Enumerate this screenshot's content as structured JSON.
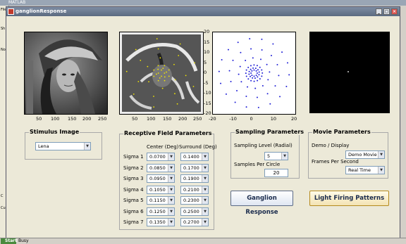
{
  "matlab": {
    "title": "MATLAB",
    "side_labels": [
      "File",
      "Sh",
      "Cu",
      "C",
      "No"
    ]
  },
  "window": {
    "title": "ganglionResponse",
    "controls": {
      "minimize": "_",
      "maximize": "▢",
      "close": "×"
    }
  },
  "axes": {
    "image_x_ticks": [
      "50",
      "100",
      "150",
      "200",
      "250"
    ],
    "scatter_x_ticks": [
      "-20",
      "-10",
      "0",
      "10",
      "20"
    ],
    "scatter_y_ticks": [
      "20",
      "15",
      "10",
      "5",
      "0",
      "-5",
      "-10",
      "-15",
      "-20"
    ]
  },
  "chart_data": {
    "type": "scatter",
    "xlim": [
      -20,
      20
    ],
    "ylim": [
      -20,
      20
    ],
    "grid": false,
    "color": "#1f1fd6",
    "rings": [
      {
        "radius": 1.5,
        "points": 8
      },
      {
        "radius": 2.5,
        "points": 12
      },
      {
        "radius": 4.0,
        "points": 16
      },
      {
        "radius": 7.5,
        "points": 12
      },
      {
        "radius": 12.0,
        "points": 14
      },
      {
        "radius": 17.0,
        "points": 18
      }
    ]
  },
  "stimulus": {
    "title": "Stimulus Image",
    "selected": "Lena"
  },
  "receptive": {
    "title": "Receptive Field Parameters",
    "center_header": "Center (Deg)",
    "surround_header": "Surround (Deg)",
    "rows": [
      {
        "label": "Sigma 1",
        "center": "0.0700",
        "surround": "0.1400"
      },
      {
        "label": "Sigma 2",
        "center": "0.0850",
        "surround": "0.1700"
      },
      {
        "label": "Sigma 3",
        "center": "0.0950",
        "surround": "0.1900"
      },
      {
        "label": "Sigma 4",
        "center": "0.1050",
        "surround": "0.2100"
      },
      {
        "label": "Sigma 5",
        "center": "0.1150",
        "surround": "0.2300"
      },
      {
        "label": "Sigma 6",
        "center": "0.1250",
        "surround": "0.2500"
      },
      {
        "label": "Sigma 7",
        "center": "0.1350",
        "surround": "0.2700"
      }
    ]
  },
  "sampling": {
    "title": "Sampling Parameters",
    "level_label": "Sampling Level (Radial)",
    "level_value": "5",
    "per_circle_label": "Samples Per Circle",
    "per_circle_value": "20"
  },
  "movie": {
    "title": "Movie Parameters",
    "demo_label": "Demo / Display",
    "demo_value": "Demo Movie",
    "fps_label": "Frames Per Second",
    "fps_value": "Real Time"
  },
  "buttons": {
    "ganglion": "Ganglion Response",
    "light_firing": "Light Firing Patterns"
  },
  "status": {
    "start": "Start",
    "busy": "Busy"
  }
}
